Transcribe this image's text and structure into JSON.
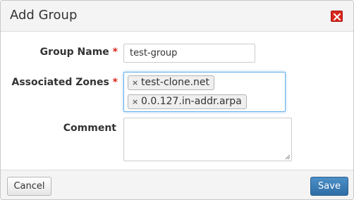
{
  "dialog": {
    "title": "Add Group",
    "close_icon": "close-icon"
  },
  "form": {
    "group_name": {
      "label": "Group Name",
      "required_mark": "*",
      "value": "test-group"
    },
    "associated_zones": {
      "label": "Associated Zones",
      "required_mark": "*",
      "chips": [
        {
          "remove_glyph": "×",
          "label": "test-clone.net"
        },
        {
          "remove_glyph": "×",
          "label": "0.0.127.in-addr.arpa"
        }
      ]
    },
    "comment": {
      "label": "Comment",
      "value": ""
    }
  },
  "footer": {
    "cancel_label": "Cancel",
    "save_label": "Save"
  },
  "colors": {
    "required": "#d9261c",
    "close_button": "#d9261c",
    "primary_button": "#337ab7",
    "focus_border": "#66afe9"
  }
}
